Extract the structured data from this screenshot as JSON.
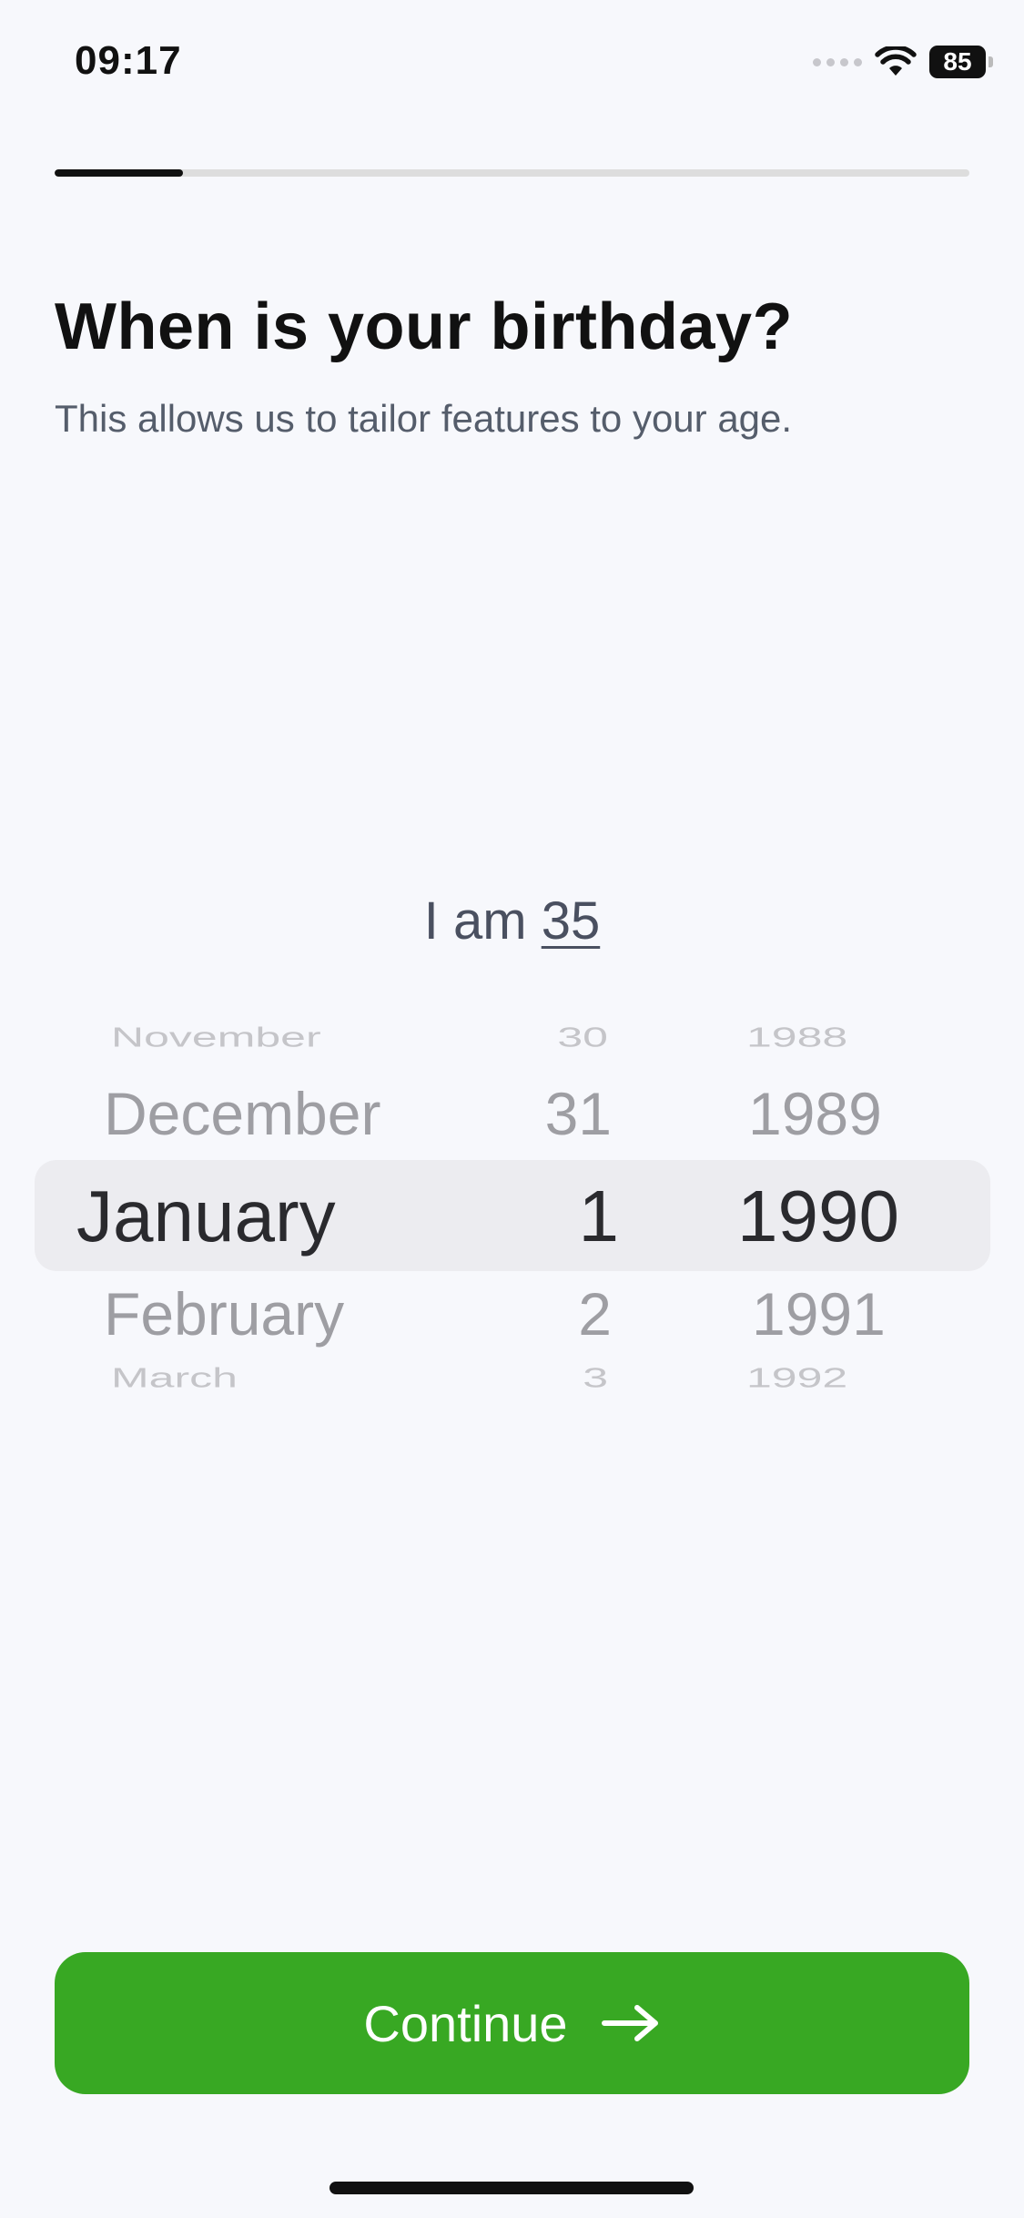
{
  "status_bar": {
    "time": "09:17",
    "battery": "85",
    "icons": [
      "signal-dots-icon",
      "wifi-icon",
      "battery-icon"
    ]
  },
  "onboarding_progress": 0.14,
  "heading": {
    "title": "When is your birthday?",
    "subtitle": "This allows us to tailor features to your age."
  },
  "age": {
    "prefix": "I am",
    "value": "35"
  },
  "picker": {
    "months": [
      "November",
      "December",
      "January",
      "February",
      "March"
    ],
    "days": [
      "30",
      "31",
      "1",
      "2",
      "3"
    ],
    "years": [
      "1988",
      "1989",
      "1990",
      "1991",
      "1992"
    ],
    "selected": {
      "month": "January",
      "day": "1",
      "year": "1990"
    }
  },
  "continue_button": {
    "label": "Continue",
    "icon": "arrow-right-icon",
    "color": "#38a823"
  }
}
